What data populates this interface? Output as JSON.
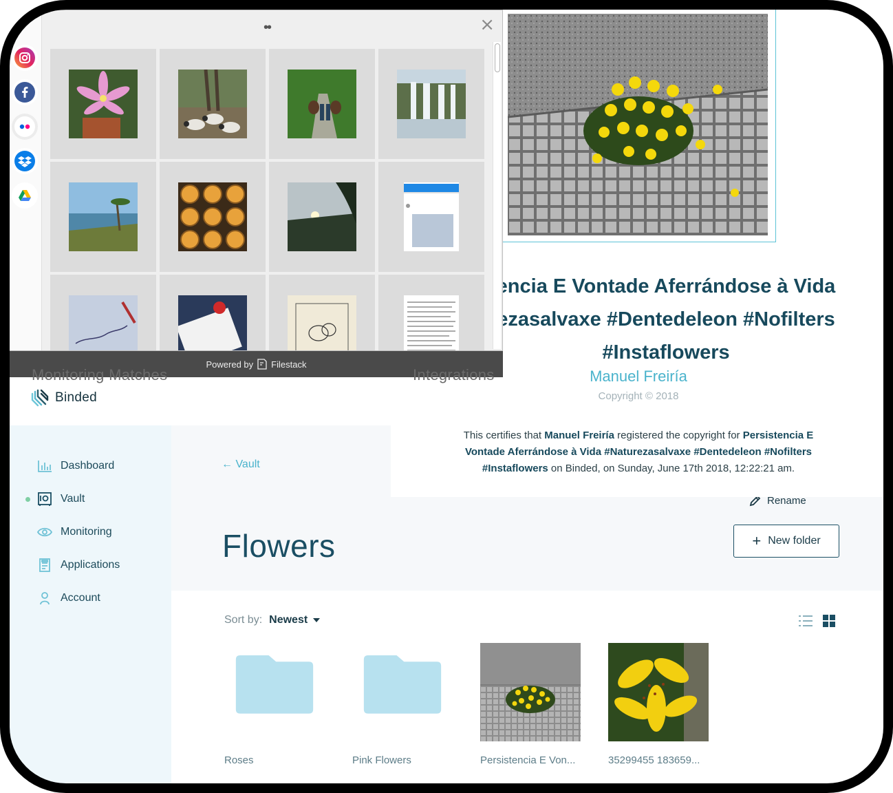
{
  "app": {
    "brand": "Binded",
    "nav": [
      {
        "label": "Dashboard",
        "icon": "bar-chart-icon"
      },
      {
        "label": "Vault",
        "icon": "vault-icon",
        "active": true
      },
      {
        "label": "Monitoring",
        "icon": "eye-icon"
      },
      {
        "label": "Applications",
        "icon": "document-icon"
      },
      {
        "label": "Account",
        "icon": "user-icon"
      }
    ],
    "back_link": "← Vault",
    "page_title": "Flowers",
    "rename_label": "Rename",
    "new_folder_label": "New folder",
    "sort_label": "Sort by:",
    "sort_value": "Newest",
    "items": [
      {
        "label": "Roses",
        "kind": "folder"
      },
      {
        "label": "Pink Flowers",
        "kind": "folder"
      },
      {
        "label": "Persistencia E Von...",
        "kind": "image"
      },
      {
        "label": "35299455 183659...",
        "kind": "image"
      }
    ],
    "ghost_tabs": [
      "Monitoring Matches",
      "Integrations"
    ]
  },
  "certificate": {
    "title_lines": [
      "encia E Vontade Aferrándose à Vida",
      "ezasalvaxe #Dentedeleon #Nofilters",
      "#Instaflowers"
    ],
    "author": "Manuel Freiría",
    "copyright": "Copyright © 2018",
    "text_prefix": "This certifies that ",
    "text_name": "Manuel Freiría",
    "text_mid": " registered the copyright for ",
    "text_work": "Persistencia E Vontade Aferrándose à Vida #Naturezasalvaxe #Dentedeleon #Nofilters #Instaflowers",
    "text_suffix": " on Binded, on Sunday, June 17th 2018, 12:22:21 am."
  },
  "picker": {
    "drag_handle": "••",
    "close": "×",
    "powered_by": "Powered by",
    "powered_brand": "Filestack",
    "sources": [
      "instagram-icon",
      "facebook-icon",
      "flickr-icon",
      "dropbox-icon",
      "google-drive-icon"
    ]
  },
  "colors": {
    "accent": "#4ab3cc",
    "title": "#1a4e63",
    "sidebar_bg": "#eef7fb",
    "folder": "#b7e1ef"
  }
}
